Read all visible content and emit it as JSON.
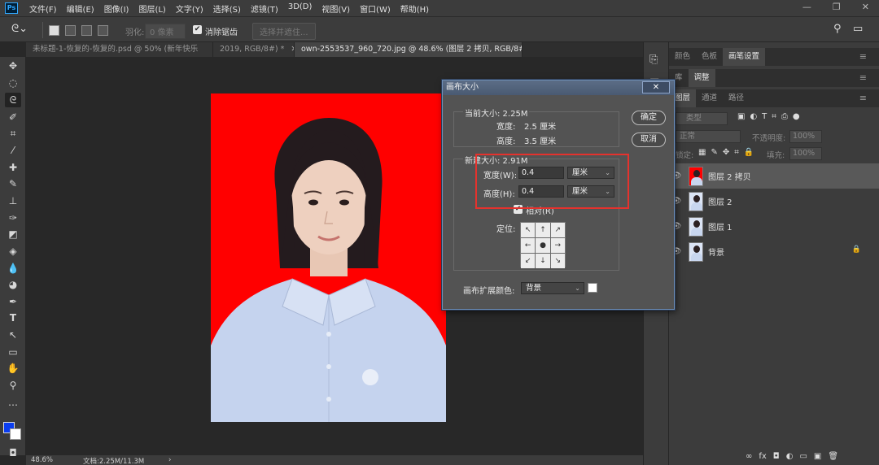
{
  "app": {
    "logo": "Ps"
  },
  "menubar": {
    "items": [
      "文件(F)",
      "编辑(E)",
      "图像(I)",
      "图层(L)",
      "文字(Y)",
      "选择(S)",
      "滤镜(T)",
      "3D(D)",
      "视图(V)",
      "窗口(W)",
      "帮助(H)"
    ]
  },
  "window_controls": {
    "minimize": "—",
    "restore": "❐",
    "close": "✕"
  },
  "options": {
    "feather_label": "羽化:",
    "feather_value": "0 像素",
    "antialias_label": "消除锯齿",
    "select_mask_label": "选择并遮住..."
  },
  "tabs": [
    {
      "label": "未标题-1-恢复的-恢复的.psd @ 50% (新年快乐",
      "close": ""
    },
    {
      "label": "2019, RGB/8#) *",
      "close": "✕"
    },
    {
      "label": "own-2553537_960_720.jpg @ 48.6% (图层 2 拷贝, RGB/8#) *",
      "close": "✕"
    }
  ],
  "status": {
    "zoom": "48.6%",
    "doc": "文档:2.25M/11.3M",
    "arrow": "›"
  },
  "dialog": {
    "title": "画布大小",
    "close": "✕",
    "current_size_label": "当前大小: 2.25M",
    "current_width_label": "宽度:",
    "current_width_value": "2.5 厘米",
    "current_height_label": "高度:",
    "current_height_value": "3.5 厘米",
    "new_size_label": "新建大小: 2.91M",
    "width_label": "宽度(W):",
    "width_value": "0.4",
    "width_unit": "厘米",
    "height_label": "高度(H):",
    "height_value": "0.4",
    "height_unit": "厘米",
    "relative_label": "相对(R)",
    "anchor_label": "定位:",
    "anchor_arrows": [
      "↖",
      "↑",
      "↗",
      "←",
      "●",
      "→",
      "↙",
      "↓",
      "↘"
    ],
    "ext_color_label": "画布扩展颜色:",
    "ext_color_value": "背景",
    "ok": "确定",
    "cancel": "取消",
    "colors": {
      "ext_swatch": "#ffffff",
      "highlight": "#e5322d"
    }
  },
  "right_panel": {
    "top_tabs": [
      "颜色",
      "色板",
      "画笔设置"
    ],
    "adjust_tabs": [
      "库",
      "调整"
    ],
    "layer_tabs": [
      "图层",
      "通道",
      "路径"
    ],
    "kind_label": "类型",
    "blend_mode": "正常",
    "opacity_label": "不透明度:",
    "opacity_value": "100%",
    "lock_label": "锁定:",
    "fill_label": "填充:",
    "fill_value": "100%",
    "layers": [
      {
        "name": "图层 2 拷贝",
        "selected": true,
        "lock": ""
      },
      {
        "name": "图层 2",
        "selected": false,
        "lock": ""
      },
      {
        "name": "图层 1",
        "selected": false,
        "lock": ""
      },
      {
        "name": "背景",
        "selected": false,
        "lock": "🔒"
      }
    ],
    "bottom_icons": [
      "∞",
      "fx",
      "◘",
      "◐",
      "▭",
      "▣",
      "🗑"
    ]
  },
  "photo": {
    "background": "#ff0000",
    "shirt_color": "#c5d3ee"
  }
}
